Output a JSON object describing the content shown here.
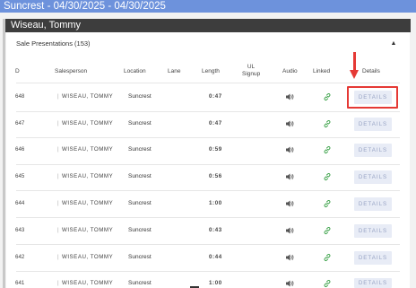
{
  "header": {
    "title": "Suncrest - 04/30/2025 - 04/30/2025"
  },
  "person": {
    "name": "Wiseau, Tommy"
  },
  "section": {
    "title": "Sale Presentations (153)",
    "collapse_icon": "chevron-up-icon"
  },
  "columns": {
    "id": "D",
    "salesperson": "Salesperson",
    "location": "Location",
    "lane": "Lane",
    "length": "Length",
    "ul_signup_1": "UL",
    "ul_signup_2": "Signup",
    "audio": "Audio",
    "linked": "Linked",
    "details": "Details"
  },
  "rows": [
    {
      "id": "648",
      "salesperson": "WISEAU, TOMMY",
      "location": "Suncrest",
      "lane": "",
      "length": "0:47",
      "details": "DETAILS"
    },
    {
      "id": "647",
      "salesperson": "WISEAU, TOMMY",
      "location": "Suncrest",
      "lane": "",
      "length": "0:47",
      "details": "DETAILS"
    },
    {
      "id": "646",
      "salesperson": "WISEAU, TOMMY",
      "location": "Suncrest",
      "lane": "",
      "length": "0:59",
      "details": "DETAILS"
    },
    {
      "id": "645",
      "salesperson": "WISEAU, TOMMY",
      "location": "Suncrest",
      "lane": "",
      "length": "0:56",
      "details": "DETAILS"
    },
    {
      "id": "644",
      "salesperson": "WISEAU, TOMMY",
      "location": "Suncrest",
      "lane": "",
      "length": "1:00",
      "details": "DETAILS"
    },
    {
      "id": "643",
      "salesperson": "WISEAU, TOMMY",
      "location": "Suncrest",
      "lane": "",
      "length": "0:43",
      "details": "DETAILS"
    },
    {
      "id": "642",
      "salesperson": "WISEAU, TOMMY",
      "location": "Suncrest",
      "lane": "",
      "length": "0:44",
      "details": "DETAILS"
    },
    {
      "id": "641",
      "salesperson": "WISEAU, TOMMY",
      "location": "Suncrest",
      "lane": "",
      "length": "1:00",
      "details": "DETAILS"
    }
  ],
  "icons": {
    "audio": "speaker-icon",
    "linked": "link-icon"
  },
  "colors": {
    "title_bar": "#6d92dc",
    "person_bar": "#3d3d3d",
    "details_button_bg": "#e8ecf6",
    "details_button_text": "#97a3c4",
    "link_icon": "#2e9b3c",
    "annotation_red": "#e53935"
  }
}
